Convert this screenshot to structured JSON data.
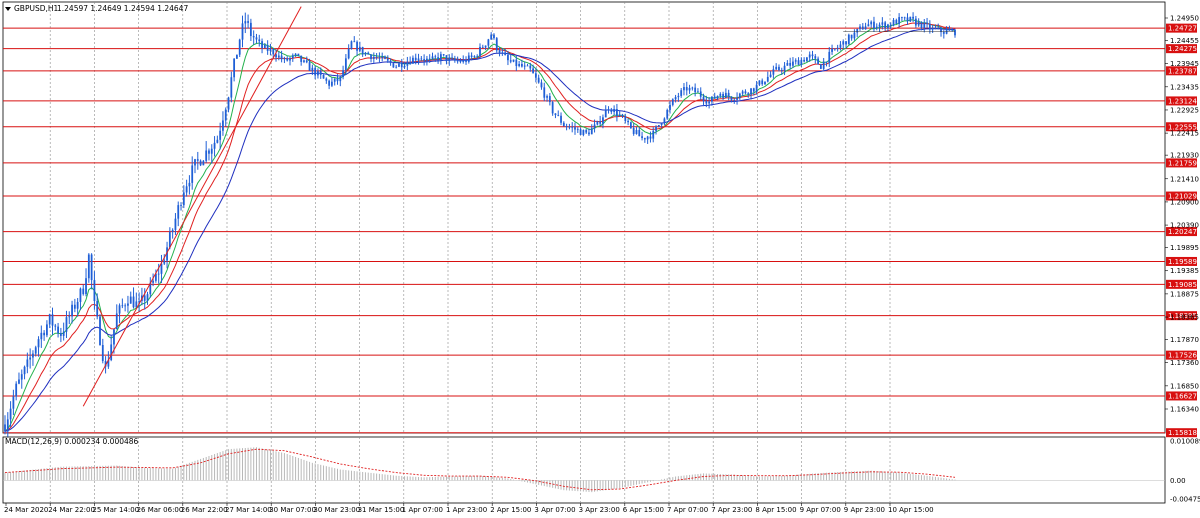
{
  "chart_data": {
    "type": "candlestick",
    "symbol_header": "GBPUSD,H1",
    "ohlc_readout": "1.24597 1.24649 1.24594 1.24647",
    "price_ticks": [
      "1.24950",
      "1.24455",
      "1.23945",
      "1.23435",
      "1.22925",
      "1.22415",
      "1.21930",
      "1.21410",
      "1.20900",
      "1.20390",
      "1.19895",
      "1.19385",
      "1.18875",
      "1.18365",
      "1.17870",
      "1.17360",
      "1.16850",
      "1.16340"
    ],
    "horizontal_levels": [
      "1.24727",
      "1.24275",
      "1.23787",
      "1.23124",
      "1.22555",
      "1.21759",
      "1.21029",
      "1.20247",
      "1.19589",
      "1.19085",
      "1.18395",
      "1.17526",
      "1.16627",
      "1.15818"
    ],
    "current_price": "1.24647",
    "time_ticks": [
      "24 Mar 2020",
      "24 Mar 22:00",
      "25 Mar 14:00",
      "26 Mar 06:00",
      "26 Mar 22:00",
      "27 Mar 14:00",
      "30 Mar 07:00",
      "30 Mar 23:00",
      "31 Mar 15:00",
      "1 Apr 07:00",
      "1 Apr 23:00",
      "2 Apr 15:00",
      "3 Apr 07:00",
      "3 Apr 23:00",
      "6 Apr 15:00",
      "7 Apr 07:00",
      "7 Apr 23:00",
      "8 Apr 15:00",
      "9 Apr 07:00",
      "9 Apr 23:00",
      "10 Apr 15:00"
    ],
    "price_path": [
      [
        0,
        1.16
      ],
      [
        4,
        1.168
      ],
      [
        8,
        1.173
      ],
      [
        12,
        1.179
      ],
      [
        16,
        1.183
      ],
      [
        20,
        1.18
      ],
      [
        24,
        1.185
      ],
      [
        28,
        1.19
      ],
      [
        30,
        1.197
      ],
      [
        32,
        1.186
      ],
      [
        36,
        1.172
      ],
      [
        40,
        1.184
      ],
      [
        44,
        1.188
      ],
      [
        48,
        1.186
      ],
      [
        52,
        1.19
      ],
      [
        56,
        1.195
      ],
      [
        60,
        1.203
      ],
      [
        64,
        1.212
      ],
      [
        68,
        1.217
      ],
      [
        72,
        1.22
      ],
      [
        76,
        1.223
      ],
      [
        80,
        1.233
      ],
      [
        84,
        1.245
      ],
      [
        86,
        1.249
      ],
      [
        88,
        1.246
      ],
      [
        92,
        1.243
      ],
      [
        96,
        1.242
      ],
      [
        100,
        1.24
      ],
      [
        104,
        1.241
      ],
      [
        108,
        1.239
      ],
      [
        112,
        1.237
      ],
      [
        116,
        1.235
      ],
      [
        120,
        1.236
      ],
      [
        124,
        1.244
      ],
      [
        128,
        1.242
      ],
      [
        132,
        1.241
      ],
      [
        136,
        1.24
      ],
      [
        140,
        1.239
      ],
      [
        144,
        1.24
      ],
      [
        148,
        1.241
      ],
      [
        152,
        1.24
      ],
      [
        156,
        1.241
      ],
      [
        160,
        1.24
      ],
      [
        164,
        1.24
      ],
      [
        168,
        1.241
      ],
      [
        172,
        1.244
      ],
      [
        174,
        1.246
      ],
      [
        176,
        1.243
      ],
      [
        180,
        1.24
      ],
      [
        184,
        1.239
      ],
      [
        188,
        1.238
      ],
      [
        192,
        1.234
      ],
      [
        196,
        1.229
      ],
      [
        200,
        1.226
      ],
      [
        204,
        1.225
      ],
      [
        208,
        1.224
      ],
      [
        212,
        1.226
      ],
      [
        216,
        1.23
      ],
      [
        220,
        1.228
      ],
      [
        224,
        1.225
      ],
      [
        228,
        1.223
      ],
      [
        232,
        1.224
      ],
      [
        236,
        1.228
      ],
      [
        240,
        1.232
      ],
      [
        244,
        1.234
      ],
      [
        248,
        1.233
      ],
      [
        252,
        1.231
      ],
      [
        256,
        1.233
      ],
      [
        260,
        1.232
      ],
      [
        264,
        1.233
      ],
      [
        268,
        1.234
      ],
      [
        272,
        1.236
      ],
      [
        276,
        1.238
      ],
      [
        280,
        1.239
      ],
      [
        284,
        1.24
      ],
      [
        288,
        1.241
      ],
      [
        292,
        1.239
      ],
      [
        296,
        1.242
      ],
      [
        300,
        1.244
      ],
      [
        304,
        1.246
      ],
      [
        308,
        1.248
      ],
      [
        312,
        1.248
      ],
      [
        316,
        1.248
      ],
      [
        320,
        1.249
      ],
      [
        324,
        1.249
      ],
      [
        328,
        1.248
      ],
      [
        332,
        1.247
      ],
      [
        336,
        1.2465
      ],
      [
        340,
        1.2465
      ]
    ],
    "macd": {
      "label": "MACD(12,26,9) 0.000234 0.000486",
      "ticks": [
        "0.010089",
        "0.00",
        "-0.004758"
      ],
      "histogram": [
        [
          0,
          0.002
        ],
        [
          20,
          0.0035
        ],
        [
          40,
          0.0038
        ],
        [
          50,
          0.0032
        ],
        [
          60,
          0.003
        ],
        [
          70,
          0.0055
        ],
        [
          80,
          0.008
        ],
        [
          90,
          0.0085
        ],
        [
          100,
          0.007
        ],
        [
          110,
          0.0045
        ],
        [
          120,
          0.0028
        ],
        [
          130,
          0.002
        ],
        [
          140,
          0.0012
        ],
        [
          150,
          0.0008
        ],
        [
          160,
          0.001
        ],
        [
          170,
          0.0012
        ],
        [
          180,
          0.0005
        ],
        [
          190,
          -0.001
        ],
        [
          200,
          -0.0025
        ],
        [
          210,
          -0.003
        ],
        [
          220,
          -0.002
        ],
        [
          230,
          -0.0005
        ],
        [
          240,
          0.001
        ],
        [
          250,
          0.0018
        ],
        [
          260,
          0.0015
        ],
        [
          270,
          0.001
        ],
        [
          280,
          0.0012
        ],
        [
          290,
          0.0018
        ],
        [
          300,
          0.0022
        ],
        [
          310,
          0.0025
        ],
        [
          320,
          0.002
        ],
        [
          330,
          0.0012
        ],
        [
          340,
          0.0002
        ]
      ],
      "signal": [
        [
          0,
          0.002
        ],
        [
          20,
          0.003
        ],
        [
          40,
          0.0034
        ],
        [
          50,
          0.0033
        ],
        [
          60,
          0.0032
        ],
        [
          70,
          0.0045
        ],
        [
          80,
          0.0068
        ],
        [
          90,
          0.008
        ],
        [
          100,
          0.0076
        ],
        [
          110,
          0.006
        ],
        [
          120,
          0.0042
        ],
        [
          130,
          0.003
        ],
        [
          140,
          0.002
        ],
        [
          150,
          0.0013
        ],
        [
          160,
          0.0011
        ],
        [
          170,
          0.0011
        ],
        [
          180,
          0.0008
        ],
        [
          190,
          -0.0001
        ],
        [
          200,
          -0.0015
        ],
        [
          210,
          -0.0024
        ],
        [
          220,
          -0.0022
        ],
        [
          230,
          -0.0012
        ],
        [
          240,
          0.0
        ],
        [
          250,
          0.001
        ],
        [
          260,
          0.0013
        ],
        [
          270,
          0.0012
        ],
        [
          280,
          0.0012
        ],
        [
          290,
          0.0015
        ],
        [
          300,
          0.0019
        ],
        [
          310,
          0.0022
        ],
        [
          320,
          0.0021
        ],
        [
          330,
          0.0016
        ],
        [
          340,
          0.0008
        ]
      ]
    },
    "colors": {
      "candles": "#1f5fd6",
      "ma_fast": "#22b14c",
      "ma_mid": "#e02020",
      "ma_slow": "#1f2fbf",
      "trendline": "#e02020",
      "levels": "#d81010",
      "grid": "#8c8c8c"
    }
  }
}
